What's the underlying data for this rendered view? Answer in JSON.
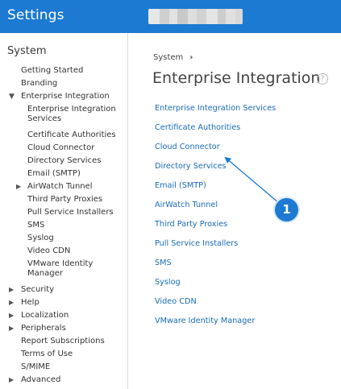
{
  "header": {
    "title": "Settings",
    "org_selector_redacted": true
  },
  "sidebar": {
    "title": "System",
    "items": [
      {
        "label": "Getting Started",
        "level": 0,
        "caret": ""
      },
      {
        "label": "Branding",
        "level": 0,
        "caret": ""
      },
      {
        "label": "Enterprise Integration",
        "level": 0,
        "caret": "down"
      },
      {
        "label": "Enterprise Integration Services",
        "level": 1,
        "caret": ""
      },
      {
        "label": "Certificate Authorities",
        "level": 1,
        "caret": ""
      },
      {
        "label": "Cloud Connector",
        "level": 1,
        "caret": ""
      },
      {
        "label": "Directory Services",
        "level": 1,
        "caret": ""
      },
      {
        "label": "Email (SMTP)",
        "level": 1,
        "caret": ""
      },
      {
        "label": "AirWatch Tunnel",
        "level": 1,
        "caret": "right"
      },
      {
        "label": "Third Party Proxies",
        "level": 1,
        "caret": ""
      },
      {
        "label": "Pull Service Installers",
        "level": 1,
        "caret": ""
      },
      {
        "label": "SMS",
        "level": 1,
        "caret": ""
      },
      {
        "label": "Syslog",
        "level": 1,
        "caret": ""
      },
      {
        "label": "Video CDN",
        "level": 1,
        "caret": ""
      },
      {
        "label": "VMware Identity Manager",
        "level": 1,
        "caret": ""
      },
      {
        "label": "Security",
        "level": 0,
        "caret": "right"
      },
      {
        "label": "Help",
        "level": 0,
        "caret": "right"
      },
      {
        "label": "Localization",
        "level": 0,
        "caret": "right"
      },
      {
        "label": "Peripherals",
        "level": 0,
        "caret": "right"
      },
      {
        "label": "Report Subscriptions",
        "level": 0,
        "caret": ""
      },
      {
        "label": "Terms of Use",
        "level": 0,
        "caret": ""
      },
      {
        "label": "S/MIME",
        "level": 0,
        "caret": ""
      },
      {
        "label": "Advanced",
        "level": 0,
        "caret": "right"
      }
    ]
  },
  "main": {
    "breadcrumb": "System",
    "breadcrumb_separator": "›",
    "title": "Enterprise Integration",
    "help_icon": "?",
    "links": [
      "Enterprise Integration Services",
      "Certificate Authorities",
      "Cloud Connector",
      "Directory Services",
      "Email (SMTP)",
      "AirWatch Tunnel",
      "Third Party Proxies",
      "Pull Service Installers",
      "SMS",
      "Syslog",
      "Video CDN",
      "VMware Identity Manager"
    ]
  },
  "callout": {
    "number": "1",
    "color": "#1c7ad2"
  },
  "colors": {
    "header_bg": "#1c7ad2",
    "link": "#1a6bb8"
  }
}
